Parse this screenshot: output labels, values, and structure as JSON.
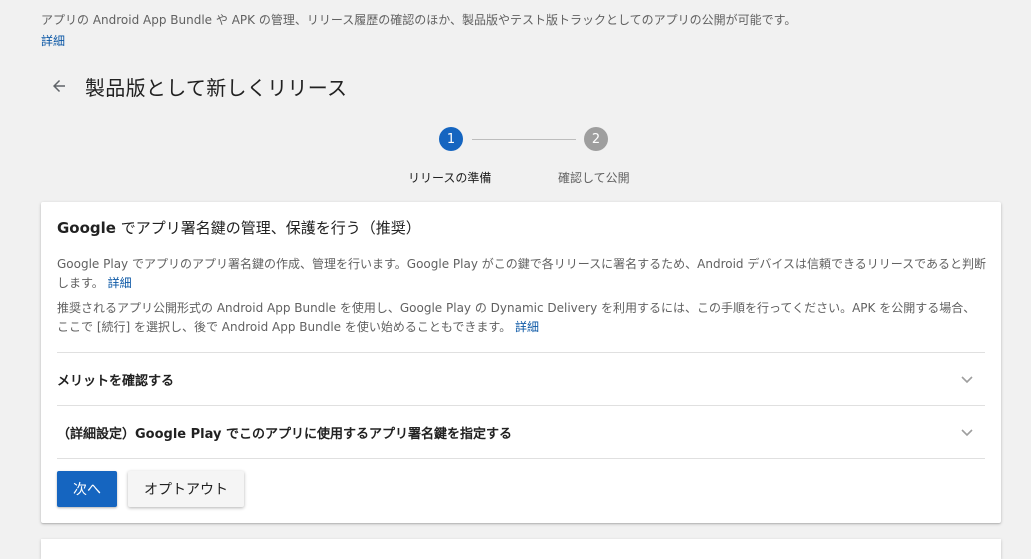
{
  "intro": {
    "text": "アプリの Android App Bundle や APK の管理、リリース履歴の確認のほか、製品版やテスト版トラックとしてのアプリの公開が可能です。",
    "link": "詳細"
  },
  "header": {
    "title": "製品版として新しくリリース"
  },
  "stepper": {
    "steps": [
      {
        "number": "1",
        "label": "リリースの準備"
      },
      {
        "number": "2",
        "label": "確認して公開"
      }
    ]
  },
  "card": {
    "title_bold": "Google",
    "title_rest": " でアプリ署名鍵の管理、保護を行う（推奨）",
    "para1": "Google Play でアプリのアプリ署名鍵の作成、管理を行います。Google Play がこの鍵で各リリースに署名するため、Android デバイスは信頼できるリリースであると判断します。",
    "para1_link": "詳細",
    "para2": "推奨されるアプリ公開形式の Android App Bundle を使用し、Google Play の Dynamic Delivery を利用するには、この手順を行ってください。APK を公開する場合、ここで [続行] を選択し、後で Android App Bundle を使い始めることもできます。",
    "para2_link": "詳細",
    "expanders": [
      {
        "label": "メリットを確認する"
      },
      {
        "label": "（詳細設定）Google Play でこのアプリに使用するアプリ署名鍵を指定する"
      }
    ],
    "next_button": "次へ",
    "optout_button": "オプトアウト"
  },
  "colors": {
    "primary": "#1565c0",
    "link": "#0b57a5",
    "step_inactive": "#9e9e9e"
  }
}
